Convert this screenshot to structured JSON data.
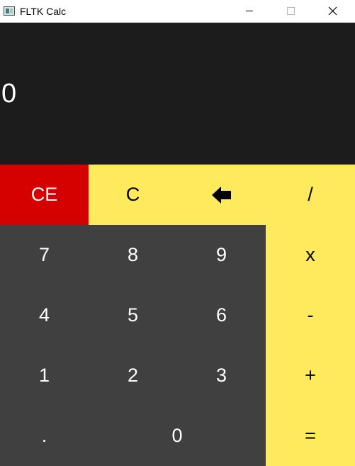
{
  "window": {
    "title": "FLTK Calc",
    "icon": "fltk-app-icon",
    "controls": [
      "minimize-icon",
      "maximize-icon",
      "close-icon"
    ]
  },
  "display": {
    "value": "0",
    "background": "#1c1c1c",
    "text_color": "#ffffff"
  },
  "keys": {
    "clear_entry": "CE",
    "clear": "C",
    "backspace_icon": "backspace-arrow-icon",
    "divide": "/",
    "seven": "7",
    "eight": "8",
    "nine": "9",
    "multiply": "x",
    "four": "4",
    "five": "5",
    "six": "6",
    "subtract": "-",
    "one": "1",
    "two": "2",
    "three": "3",
    "add": "+",
    "decimal": ".",
    "zero": "0",
    "equals": "="
  },
  "colors": {
    "number_keys": "#404040",
    "operator_keys": "#ffe95c",
    "clear_entry_key": "#d50000"
  }
}
